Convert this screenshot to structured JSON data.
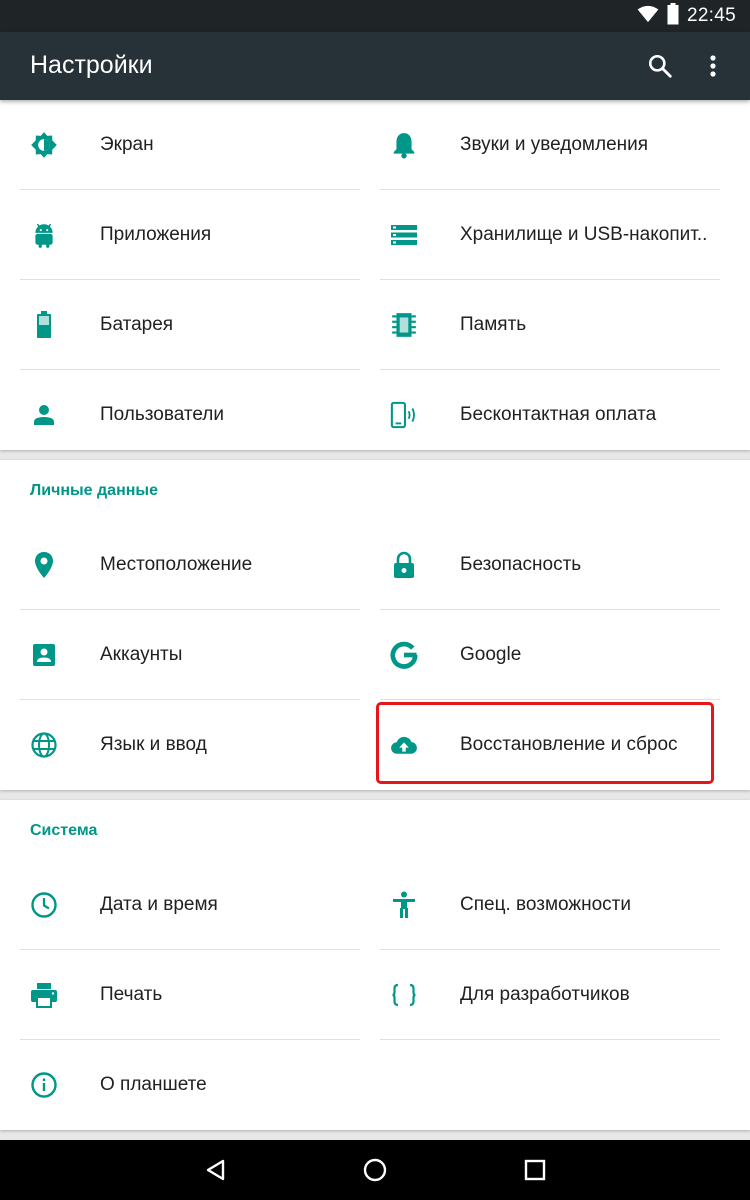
{
  "status_bar": {
    "time": "22:45",
    "icons": [
      "wifi-icon",
      "battery-icon"
    ]
  },
  "toolbar": {
    "title": "Настройки",
    "actions": [
      "search-icon",
      "more-vert-icon"
    ]
  },
  "device": {
    "items": [
      {
        "label": "Экран",
        "icon": "brightness-icon"
      },
      {
        "label": "Звуки и уведомления",
        "icon": "bell-icon"
      },
      {
        "label": "Приложения",
        "icon": "android-icon"
      },
      {
        "label": "Хранилище и USB-накопит..",
        "icon": "storage-icon"
      },
      {
        "label": "Батарея",
        "icon": "battery-icon"
      },
      {
        "label": "Память",
        "icon": "memory-chip-icon"
      },
      {
        "label": "Пользователи",
        "icon": "person-icon"
      },
      {
        "label": "Бесконтактная оплата",
        "icon": "nfc-phone-icon"
      }
    ]
  },
  "personal": {
    "title": "Личные данные",
    "items": [
      {
        "label": "Местоположение",
        "icon": "location-pin-icon"
      },
      {
        "label": "Безопасность",
        "icon": "lock-icon"
      },
      {
        "label": "Аккаунты",
        "icon": "account-box-icon"
      },
      {
        "label": "Google",
        "icon": "google-g-icon"
      },
      {
        "label": "Язык и ввод",
        "icon": "globe-icon"
      },
      {
        "label": "Восстановление и сброс",
        "icon": "cloud-upload-icon"
      }
    ]
  },
  "system": {
    "title": "Система",
    "items": [
      {
        "label": "Дата и время",
        "icon": "clock-icon"
      },
      {
        "label": "Спец. возможности",
        "icon": "accessibility-icon"
      },
      {
        "label": "Печать",
        "icon": "printer-icon"
      },
      {
        "label": "Для разработчиков",
        "icon": "braces-icon"
      },
      {
        "label": "О планшете",
        "icon": "info-icon"
      }
    ]
  },
  "colors": {
    "accent": "#009688",
    "toolbar": "#263238",
    "statusbar": "#1f2426",
    "highlight": "#e8141b"
  },
  "nav_bar": {
    "buttons": [
      "back-icon",
      "home-icon",
      "recents-icon"
    ]
  }
}
